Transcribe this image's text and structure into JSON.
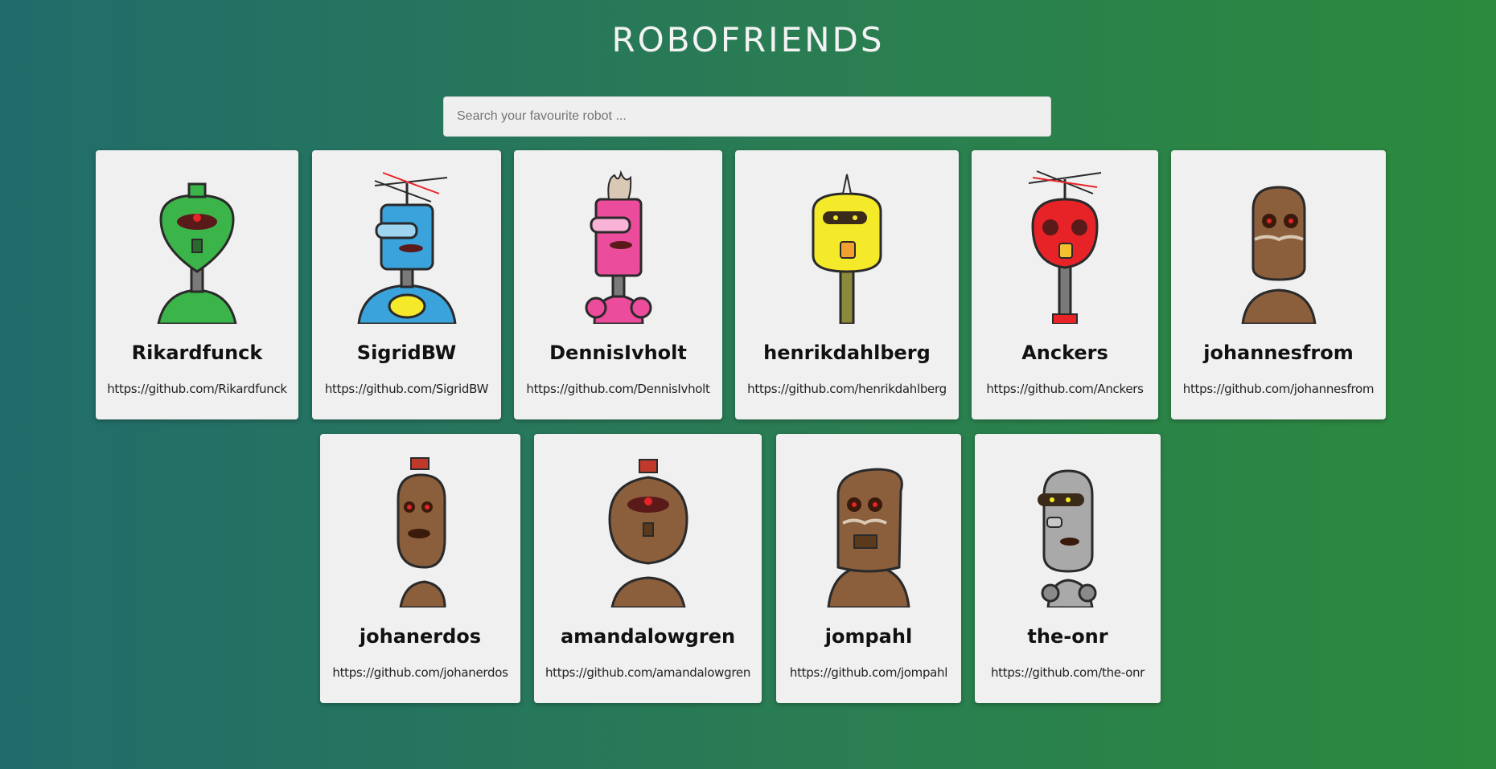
{
  "app": {
    "title": "ROBOFRIENDS"
  },
  "search": {
    "placeholder": "Search your favourite robot ..."
  },
  "robots": [
    {
      "name": "Rikardfunck",
      "url": "https://github.com/Rikardfunck",
      "icon": "green-robot-icon",
      "color": "#3bb54a"
    },
    {
      "name": "SigridBW",
      "url": "https://github.com/SigridBW",
      "icon": "blue-robot-icon",
      "color": "#3aa3dc"
    },
    {
      "name": "DennisIvholt",
      "url": "https://github.com/DennisIvholt",
      "icon": "pink-robot-icon",
      "color": "#ec4c9c"
    },
    {
      "name": "henrikdahlberg",
      "url": "https://github.com/henrikdahlberg",
      "icon": "yellow-robot-icon",
      "color": "#f5ea2a"
    },
    {
      "name": "Anckers",
      "url": "https://github.com/Anckers",
      "icon": "red-robot-icon",
      "color": "#e82328"
    },
    {
      "name": "johannesfrom",
      "url": "https://github.com/johannesfrom",
      "icon": "brown-robot-icon",
      "color": "#8b5e3c"
    },
    {
      "name": "johanerdos",
      "url": "https://github.com/johanerdos",
      "icon": "brown-robot-icon",
      "color": "#8b5e3c"
    },
    {
      "name": "amandalowgren",
      "url": "https://github.com/amandalowgren",
      "icon": "brown-robot-icon",
      "color": "#8b5e3c"
    },
    {
      "name": "jompahl",
      "url": "https://github.com/jompahl",
      "icon": "brown-robot-icon",
      "color": "#8b5e3c"
    },
    {
      "name": "the-onr",
      "url": "https://github.com/the-onr",
      "icon": "silver-robot-icon",
      "color": "#a9a9a9"
    }
  ]
}
